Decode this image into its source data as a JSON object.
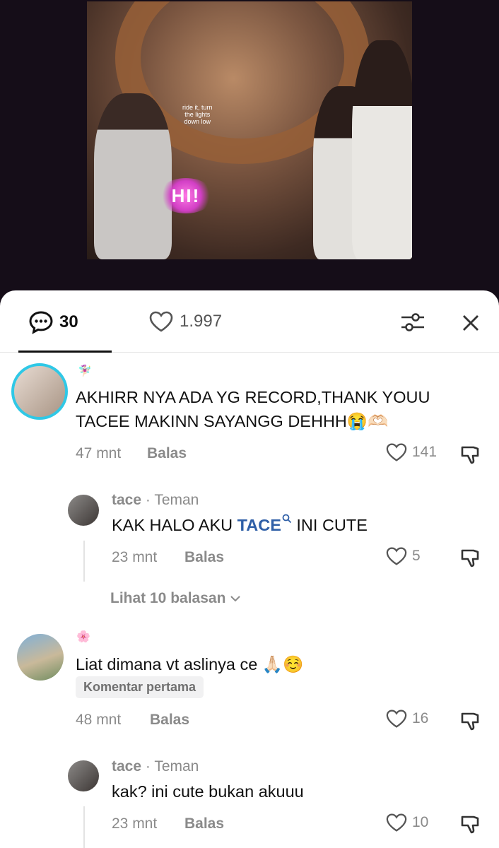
{
  "video": {
    "lyric_line1": "ride it, turn",
    "lyric_line2": "the   lights",
    "lyric_line3": "down   low",
    "sticker_text": "HI!"
  },
  "tabs": {
    "comments_count": "30",
    "likes_count": "1.997"
  },
  "comments": [
    {
      "text_line1": "AKHIRR NYA ADA YG RECORD,THANK YOUU",
      "text_line2": "TACEE MAKINN SAYANGG DEHHH😭🫶🏻",
      "time": "47 mnt",
      "reply_label": "Balas",
      "likes": "141",
      "flair": "🧚🏻‍♀️",
      "replies": [
        {
          "author": "tace",
          "relation": "· Teman",
          "text_before": "KAK HALO AKU ",
          "tag": "TACE",
          "text_after": " INI CUTE",
          "time": "23 mnt",
          "reply_label": "Balas",
          "likes": "5"
        }
      ],
      "view_more": "Lihat 10 balasan"
    },
    {
      "text_line1": "Liat dimana vt aslinya ce 🙏🏻☺️",
      "badge": "Komentar pertama",
      "time": "48 mnt",
      "reply_label": "Balas",
      "likes": "16",
      "flair": "🌸",
      "replies": [
        {
          "author": "tace",
          "relation": "· Teman",
          "text": "kak? ini cute bukan akuuu",
          "time": "23 mnt",
          "reply_label": "Balas",
          "likes": "10"
        }
      ]
    }
  ]
}
